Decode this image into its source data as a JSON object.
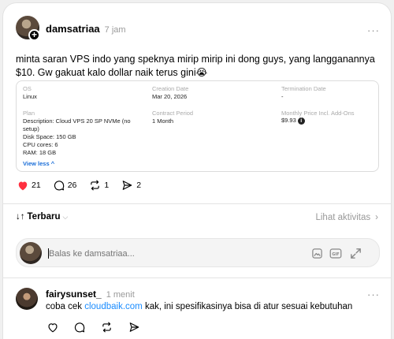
{
  "post": {
    "username": "damsatriaa",
    "time": "7 jam",
    "more": "···",
    "text": "minta saran VPS indo yang speknya mirip mirip ini dong guys, yang langganannya $10. Gw gakuat kalo dollar naik terus gini😭"
  },
  "embed": {
    "os_label": "OS",
    "os_value": "Linux",
    "created_label": "Creation Date",
    "created_value": "Mar 20, 2026",
    "term_label": "Termination Date",
    "term_value": "-",
    "plan_label": "Plan",
    "plan_lines": [
      "Description: Cloud VPS 20 SP NVMe (no",
      "setup)",
      "Disk Space: 150 GB",
      "CPU cores: 6",
      "RAM: 18 GB"
    ],
    "period_label": "Contract Period",
    "period_value": "1 Month",
    "price_label": "Monthly Price Incl. Add-Ons",
    "price_value": "$9.93",
    "view_less": "View less ^"
  },
  "stats": {
    "likes": "21",
    "comments": "26",
    "reposts": "1",
    "shares": "2"
  },
  "sort": {
    "label": "Terbaru",
    "activity": "Lihat aktivitas"
  },
  "reply": {
    "placeholder": "Balas ke damsatriaa..."
  },
  "comment": {
    "username": "fairysunset_",
    "time": "1 menit",
    "more": "···",
    "text_before": "coba cek ",
    "link": "cloudbaik.com",
    "text_after": " kak, ini spesifikasinya bisa di atur sesuai kebutuhan"
  },
  "colors": {
    "like_red": "#ff3040",
    "link_blue": "#1a8cff"
  }
}
